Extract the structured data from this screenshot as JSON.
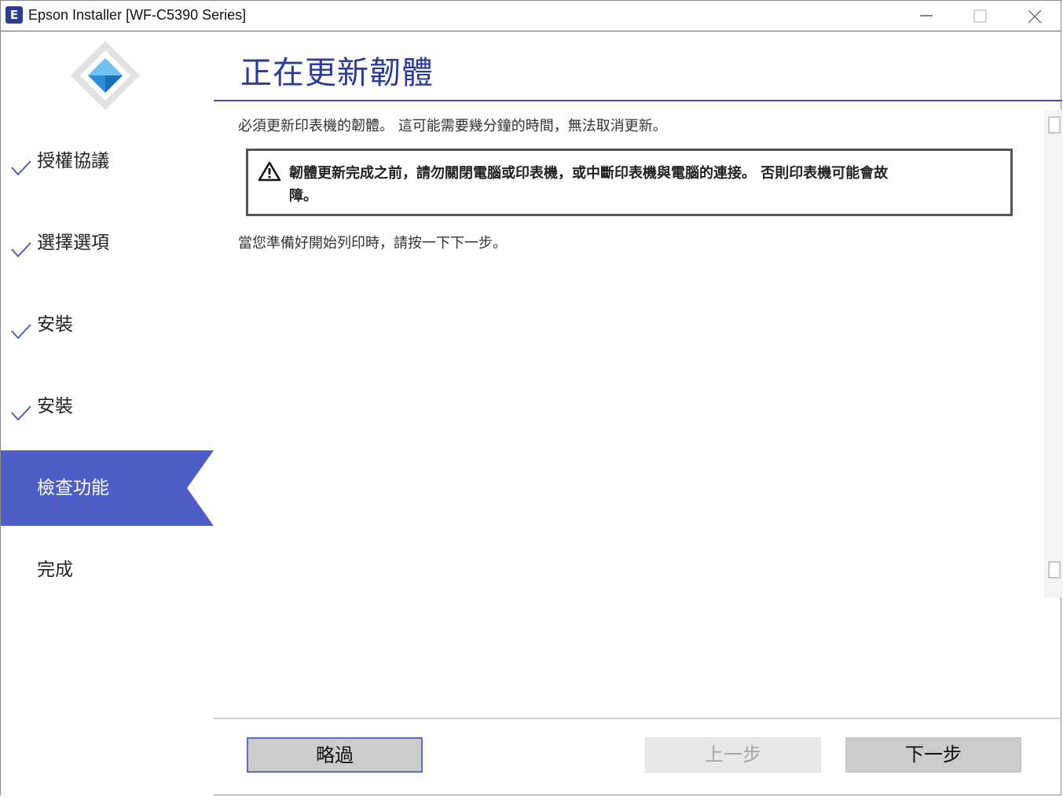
{
  "window": {
    "title": "Epson Installer [WF-C5390 Series]",
    "app_icon_letter": "E",
    "minimize_icon": "minimize-icon",
    "maximize_icon": "maximize-icon",
    "close_icon": "close-icon"
  },
  "sidebar": {
    "logo_icon": "epson-diamond-logo-icon",
    "steps": [
      {
        "label": "授權協議",
        "status": "done"
      },
      {
        "label": "選擇選項",
        "status": "done"
      },
      {
        "label": "安裝",
        "status": "done"
      },
      {
        "label": "安裝",
        "status": "done"
      },
      {
        "label": "檢查功能",
        "status": "active"
      },
      {
        "label": "完成",
        "status": "pending"
      }
    ]
  },
  "main": {
    "title": "正在更新韌體",
    "description": "必須更新印表機的韌體。 這可能需要幾分鐘的時間，無法取消更新。",
    "warning": {
      "icon": "warning-triangle-icon",
      "line1": "韌體更新完成之前，請勿關閉電腦或印表機，或中斷印表機與電腦的連接。 否則印表機可能會故",
      "line2": "障。"
    },
    "instruction": "當您準備好開始列印時，請按一下下一步。"
  },
  "buttons": {
    "skip": "略過",
    "back": "上一步",
    "next": "下一步"
  },
  "colors": {
    "accent": "#4d5fc6",
    "title": "#2a3b9a",
    "check": "#4d5fc6"
  }
}
